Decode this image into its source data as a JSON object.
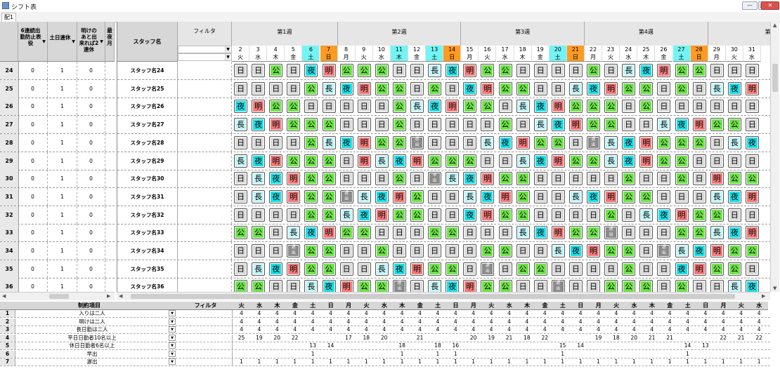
{
  "window": {
    "title": "シフト表",
    "buttons": {
      "minimize": "—",
      "maximize": "□",
      "close": "✕"
    }
  },
  "sheet_tab": "配1",
  "left_headers": [
    "6連続出勤防止表役",
    "土日連休",
    "明けのあと出来れば2連休",
    "最夜月"
  ],
  "staff_header": "スタッフ名",
  "filter_label": "フィルタ",
  "weeks": [
    "第1週",
    "第2週",
    "第3週",
    "第4週",
    "第5"
  ],
  "days": [
    {
      "d": "2",
      "w": "火"
    },
    {
      "d": "3",
      "w": "水"
    },
    {
      "d": "4",
      "w": "木"
    },
    {
      "d": "5",
      "w": "金"
    },
    {
      "d": "6",
      "w": "土"
    },
    {
      "d": "7",
      "w": "日"
    },
    {
      "d": "8",
      "w": "月"
    },
    {
      "d": "9",
      "w": "火"
    },
    {
      "d": "10",
      "w": "水"
    },
    {
      "d": "11",
      "w": "木"
    },
    {
      "d": "12",
      "w": "金"
    },
    {
      "d": "13",
      "w": "土"
    },
    {
      "d": "14",
      "w": "日"
    },
    {
      "d": "15",
      "w": "月"
    },
    {
      "d": "16",
      "w": "火"
    },
    {
      "d": "17",
      "w": "水"
    },
    {
      "d": "18",
      "w": "木"
    },
    {
      "d": "19",
      "w": "金"
    },
    {
      "d": "20",
      "w": "土"
    },
    {
      "d": "21",
      "w": "日"
    },
    {
      "d": "22",
      "w": "月"
    },
    {
      "d": "23",
      "w": "火"
    },
    {
      "d": "24",
      "w": "水"
    },
    {
      "d": "25",
      "w": "木"
    },
    {
      "d": "26",
      "w": "金"
    },
    {
      "d": "27",
      "w": "土"
    },
    {
      "d": "28",
      "w": "日"
    },
    {
      "d": "29",
      "w": "月"
    },
    {
      "d": "30",
      "w": "火"
    },
    {
      "d": "31",
      "w": "水"
    }
  ],
  "highlight_days": {
    "sat": [
      "6",
      "13",
      "20",
      "27"
    ],
    "sun": [
      "7",
      "14",
      "21",
      "28"
    ],
    "cyan_extra": [
      "11"
    ]
  },
  "rows": [
    {
      "n": "24",
      "a": "0",
      "b": "1",
      "c": "0",
      "name": "スタッフ名24",
      "shifts": [
        "日",
        "日",
        "公",
        "日",
        "夜",
        "明",
        "公",
        "公",
        "公",
        "日",
        "日",
        "長",
        "夜",
        "明",
        "公",
        "公",
        "日",
        "日",
        "日",
        "日",
        "公",
        "日",
        "長",
        "夜",
        "明",
        "公",
        "公",
        "日",
        "日",
        "日"
      ]
    },
    {
      "n": "25",
      "a": "0",
      "b": "1",
      "c": "0",
      "name": "スタッフ名25",
      "shifts": [
        "日",
        "日",
        "日",
        "日",
        "公",
        "長",
        "夜",
        "明",
        "公",
        "公",
        "日",
        "公",
        "日",
        "夜",
        "明",
        "公",
        "公",
        "日",
        "日",
        "長",
        "夜",
        "明",
        "公",
        "公",
        "日",
        "公",
        "日",
        "長",
        "夜",
        "明"
      ]
    },
    {
      "n": "26",
      "a": "0",
      "b": "1",
      "c": "0",
      "name": "スタッフ名26",
      "shifts": [
        "夜",
        "明",
        "公",
        "公",
        "日",
        "日",
        "日",
        "日",
        "日",
        "公",
        "長",
        "夜",
        "明",
        "公",
        "公",
        "日",
        "長",
        "夜",
        "明",
        "公",
        "公",
        "公",
        "日",
        "公",
        "日",
        "日",
        "日",
        "日",
        "日",
        "日"
      ]
    },
    {
      "n": "27",
      "a": "0",
      "b": "1",
      "c": "0",
      "name": "スタッフ名27",
      "shifts": [
        "長",
        "夜",
        "明",
        "公",
        "公",
        "公",
        "日",
        "日",
        "日",
        "公",
        "日",
        "日",
        "日",
        "日",
        "日",
        "公",
        "日",
        "長",
        "夜",
        "明",
        "公",
        "公",
        "日",
        "日",
        "長",
        "夜",
        "明",
        "公",
        "公",
        "日"
      ]
    },
    {
      "n": "28",
      "a": "0",
      "b": "1",
      "c": "0",
      "name": "スタッフ名28",
      "shifts": [
        "日",
        "日",
        "日",
        "日",
        "公",
        "長",
        "夜",
        "明",
        "公",
        "公",
        "遅出",
        "日",
        "日",
        "日",
        "長",
        "夜",
        "明",
        "公",
        "公",
        "日",
        "遅出",
        "長",
        "夜",
        "明",
        "公",
        "公",
        "公",
        "日",
        "長",
        "夜"
      ]
    },
    {
      "n": "29",
      "a": "0",
      "b": "1",
      "c": "0",
      "name": "スタッフ名29",
      "shifts": [
        "長",
        "夜",
        "明",
        "公",
        "公",
        "公",
        "日",
        "明",
        "長",
        "夜",
        "明",
        "公",
        "公",
        "公",
        "日",
        "日",
        "長",
        "夜",
        "明",
        "公",
        "公",
        "長",
        "夜",
        "明",
        "公",
        "公",
        "日",
        "日",
        "日",
        "日"
      ]
    },
    {
      "n": "30",
      "a": "0",
      "b": "1",
      "c": "0",
      "name": "スタッフ名30",
      "shifts": [
        "日",
        "長",
        "夜",
        "明",
        "公",
        "公",
        "日",
        "日",
        "日",
        "公",
        "日",
        "早出",
        "長",
        "夜",
        "明",
        "公",
        "公",
        "日",
        "日",
        "日",
        "日",
        "日",
        "公",
        "日",
        "日",
        "公",
        "日",
        "明",
        "公",
        "公"
      ]
    },
    {
      "n": "31",
      "a": "0",
      "b": "1",
      "c": "0",
      "name": "スタッフ名31",
      "shifts": [
        "日",
        "長",
        "夜",
        "明",
        "公",
        "公",
        "遅出",
        "長",
        "夜",
        "明",
        "公",
        "日",
        "日",
        "長",
        "夜",
        "明",
        "公",
        "日",
        "日",
        "長",
        "夜",
        "明",
        "公",
        "公",
        "日",
        "日",
        "日",
        "長",
        "夜",
        "明"
      ]
    },
    {
      "n": "32",
      "a": "0",
      "b": "1",
      "c": "0",
      "name": "スタッフ名32",
      "shifts": [
        "日",
        "日",
        "日",
        "日",
        "公",
        "公",
        "長",
        "夜",
        "明",
        "公",
        "公",
        "日",
        "日",
        "夜",
        "明",
        "公",
        "公",
        "日",
        "日",
        "日",
        "日",
        "公",
        "日",
        "長",
        "夜",
        "明",
        "公",
        "公",
        "日",
        "日"
      ]
    },
    {
      "n": "33",
      "a": "0",
      "b": "1",
      "c": "0",
      "name": "スタッフ名33",
      "shifts": [
        "公",
        "公",
        "日",
        "長",
        "夜",
        "明",
        "公",
        "公",
        "日",
        "日",
        "日",
        "公",
        "公",
        "日",
        "日",
        "日",
        "長",
        "夜",
        "明",
        "公",
        "公",
        "遅出",
        "日",
        "日",
        "日",
        "公",
        "公",
        "長",
        "夜",
        "明"
      ]
    },
    {
      "n": "34",
      "a": "0",
      "b": "1",
      "c": "0",
      "name": "スタッフ名34",
      "shifts": [
        "日",
        "日",
        "日",
        "遅出",
        "公",
        "公",
        "日",
        "日",
        "公",
        "日",
        "日",
        "日",
        "日",
        "日",
        "公",
        "公",
        "日",
        "日",
        "長",
        "夜",
        "明",
        "公",
        "公",
        "日",
        "遅出",
        "長",
        "夜",
        "明",
        "公",
        "公"
      ]
    },
    {
      "n": "35",
      "a": "0",
      "b": "1",
      "c": "0",
      "name": "スタッフ名35",
      "shifts": [
        "日",
        "長",
        "夜",
        "明",
        "公",
        "公",
        "日",
        "日",
        "長",
        "夜",
        "明",
        "公",
        "公",
        "日",
        "遅出",
        "日",
        "公",
        "公",
        "日",
        "日",
        "日",
        "日",
        "公",
        "日",
        "日",
        "夜",
        "明",
        "公",
        "公",
        "日"
      ]
    },
    {
      "n": "36",
      "a": "0",
      "b": "1",
      "c": "0",
      "name": "スタッフ名36",
      "shifts": [
        "公",
        "公",
        "日",
        "日",
        "長",
        "夜",
        "明",
        "公",
        "公",
        "遅出",
        "日",
        "長",
        "夜",
        "明",
        "公",
        "公",
        "日",
        "日",
        "遅出",
        "日",
        "日",
        "公",
        "公",
        "公",
        "日",
        "公",
        "日",
        "日",
        "長",
        "夜"
      ]
    }
  ],
  "constraints": {
    "header_item": "制約項目",
    "header_filter": "フィルタ",
    "weekdays": [
      "火",
      "水",
      "木",
      "金",
      "土",
      "日",
      "月",
      "火",
      "水",
      "木",
      "金",
      "土",
      "日",
      "月",
      "火",
      "水",
      "木",
      "金",
      "土",
      "日",
      "月",
      "火",
      "水",
      "木",
      "金",
      "土",
      "日",
      "月",
      "火",
      "水"
    ],
    "rows": [
      {
        "n": "1",
        "label": "入りは二人",
        "vals": [
          "4",
          "4",
          "4",
          "4",
          "4",
          "4",
          "4",
          "4",
          "4",
          "4",
          "4",
          "4",
          "4",
          "4",
          "4",
          "4",
          "4",
          "4",
          "4",
          "4",
          "4",
          "4",
          "4",
          "4",
          "4",
          "4",
          "4",
          "4",
          "4",
          "4"
        ]
      },
      {
        "n": "2",
        "label": "明けは二人",
        "vals": [
          "4",
          "4",
          "4",
          "4",
          "4",
          "4",
          "4",
          "4",
          "4",
          "4",
          "4",
          "4",
          "4",
          "4",
          "4",
          "4",
          "4",
          "4",
          "4",
          "4",
          "4",
          "4",
          "4",
          "4",
          "4",
          "4",
          "4",
          "4",
          "4",
          "4"
        ]
      },
      {
        "n": "3",
        "label": "長日勤は二人",
        "vals": [
          "4",
          "4",
          "4",
          "4",
          "4",
          "4",
          "4",
          "4",
          "4",
          "4",
          "4",
          "4",
          "4",
          "4",
          "4",
          "4",
          "4",
          "4",
          "4",
          "4",
          "4",
          "4",
          "4",
          "4",
          "4",
          "4",
          "4",
          "4",
          "4",
          "4"
        ]
      },
      {
        "n": "4",
        "label": "平日日勤者10名以上",
        "vals": [
          "25",
          "19",
          "20",
          "22",
          "",
          "",
          "17",
          "18",
          "20",
          "",
          "21",
          "",
          "",
          "20",
          "19",
          "21",
          "18",
          "22",
          "",
          "",
          "19",
          "18",
          "20",
          "21",
          "21",
          "",
          "",
          "22",
          "21",
          "22"
        ]
      },
      {
        "n": "5",
        "label": "休日日勤者6名以上",
        "vals": [
          "",
          "",
          "",
          "",
          "13",
          "14",
          "",
          "",
          "",
          "18",
          "",
          "18",
          "16",
          "",
          "",
          "",
          "",
          "",
          "15",
          "14",
          "",
          "",
          "",
          "",
          "",
          "14",
          "13",
          "",
          "",
          ""
        ]
      },
      {
        "n": "6",
        "label": "早出",
        "vals": [
          "",
          "",
          "",
          "",
          "1",
          "",
          "",
          "",
          "",
          "1",
          "",
          "1",
          "1",
          "",
          "",
          "",
          "",
          "",
          "1",
          "",
          "",
          "",
          "",
          "",
          "",
          "1",
          "",
          "",
          "",
          ""
        ]
      },
      {
        "n": "7",
        "label": "遅出",
        "vals": [
          "1",
          "1",
          "1",
          "1",
          "1",
          "1",
          "1",
          "1",
          "1",
          "1",
          "1",
          "1",
          "1",
          "1",
          "1",
          "1",
          "1",
          "1",
          "1",
          "1",
          "1",
          "1",
          "1",
          "1",
          "1",
          "1",
          "1",
          "1",
          "1",
          "1"
        ]
      }
    ]
  },
  "colors": {
    "日": "#dcdcdc",
    "公": "#6fe34a",
    "夜": "#18e0e8",
    "明": "#f47a7a",
    "長": "#c3f6f9",
    "遅出": "#8a8a8a",
    "早出": "#8a8a8a",
    "saturday": "#73f4f4",
    "sunday": "#ff9a22"
  }
}
